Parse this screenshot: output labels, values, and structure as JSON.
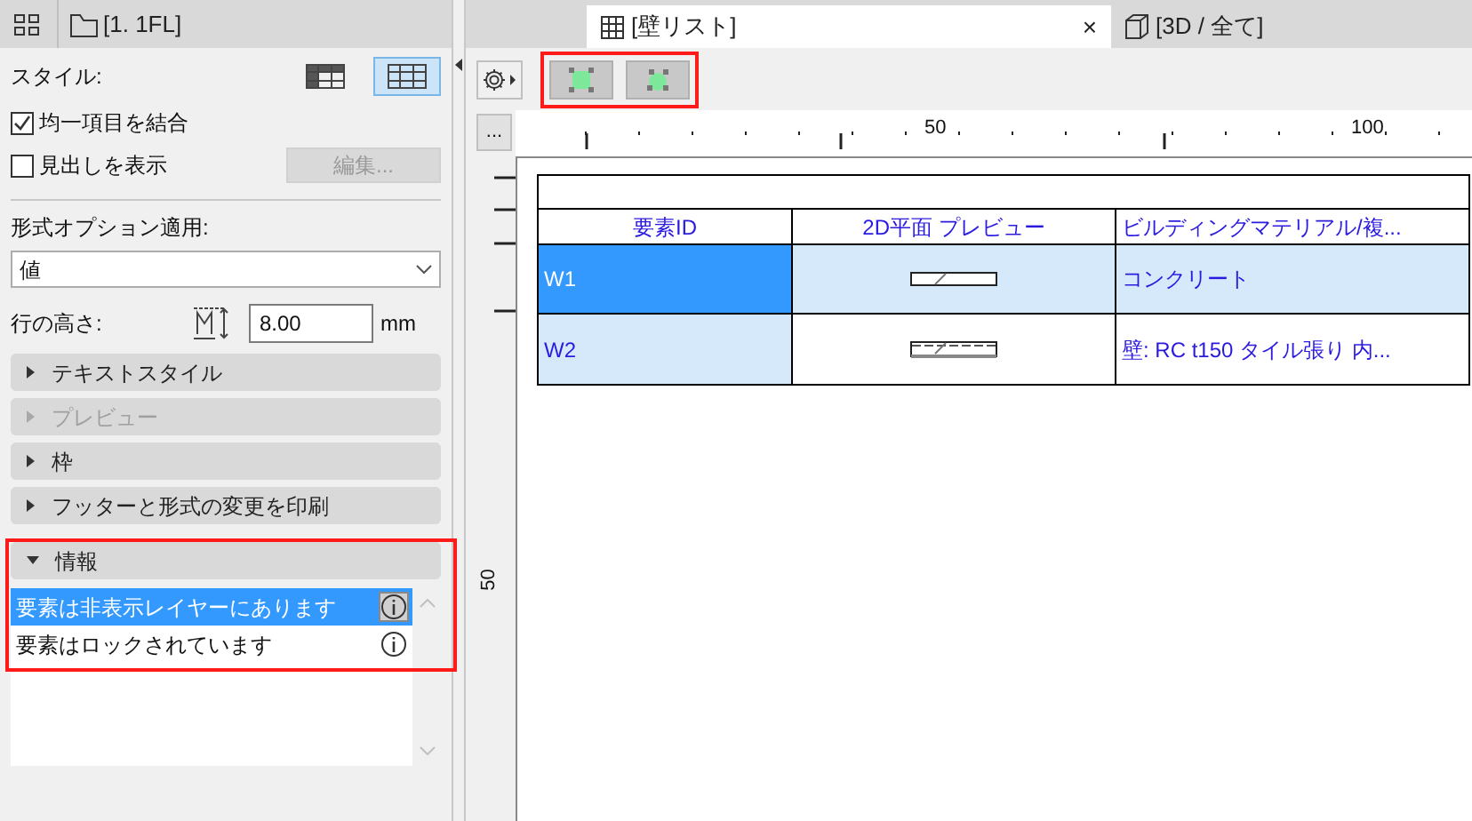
{
  "left_tab": {
    "label": "[1. 1FL]"
  },
  "tabs": [
    {
      "label": "[壁リスト]",
      "kind": "table",
      "selected": true,
      "close": "×"
    },
    {
      "label": "[3D / 全て]",
      "kind": "cube",
      "selected": false
    }
  ],
  "style": {
    "label": "スタイル:",
    "options": [
      {
        "kind": "dark-header",
        "selected": false
      },
      {
        "kind": "plain",
        "selected": true
      }
    ]
  },
  "checkboxes": [
    {
      "label": "均一項目を結合",
      "checked": true
    },
    {
      "label": "見出しを表示",
      "checked": false
    }
  ],
  "edit_button": {
    "label": "編集...",
    "disabled": true
  },
  "format": {
    "label": "形式オプション適用:",
    "value": "値"
  },
  "row_height": {
    "label": "行の高さ:",
    "value": "8.00",
    "unit": "mm"
  },
  "sections": [
    {
      "label": "テキストスタイル",
      "expanded": false,
      "disabled": false
    },
    {
      "label": "プレビュー",
      "expanded": false,
      "disabled": true
    },
    {
      "label": "枠",
      "expanded": false,
      "disabled": false
    },
    {
      "label": "フッターと形式の変更を印刷",
      "expanded": false,
      "disabled": false
    },
    {
      "label": "情報",
      "expanded": true,
      "disabled": false
    }
  ],
  "info_items": [
    {
      "text": "要素は非表示レイヤーにあります",
      "selected": true
    },
    {
      "text": "要素はロックされています",
      "selected": false
    }
  ],
  "more_button": "...",
  "ruler": {
    "top_labels": [
      "50",
      "100"
    ],
    "side_labels": [
      "50"
    ]
  },
  "table": {
    "columns": [
      "要素ID",
      "2D平面 プレビュー",
      "ビルディングマテリアル/複..."
    ],
    "rows": [
      {
        "id": "W1",
        "kind": "single",
        "material": "コンクリート",
        "selected": true
      },
      {
        "id": "W2",
        "kind": "layered",
        "material": "壁: RC t150 タイル張り 内...",
        "selected": false
      }
    ]
  }
}
